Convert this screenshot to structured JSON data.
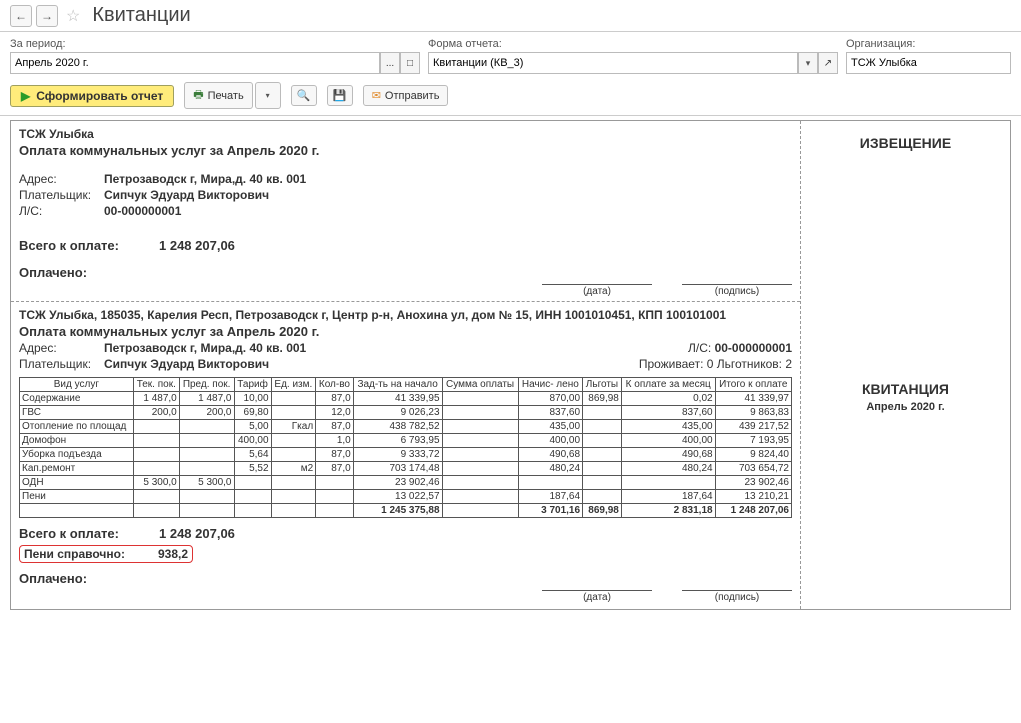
{
  "header": {
    "title": "Квитанции"
  },
  "filters": {
    "period_label": "За период:",
    "period_value": "Апрель 2020 г.",
    "form_label": "Форма отчета:",
    "form_value": "Квитанции (КВ_3)",
    "org_label": "Организация:",
    "org_value": "ТСЖ Улыбка"
  },
  "toolbar": {
    "run_label": "Сформировать отчет",
    "print_label": "Печать",
    "send_label": "Отправить"
  },
  "notice": {
    "title": "ИЗВЕЩЕНИЕ"
  },
  "receipt_side": {
    "title": "КВИТАНЦИЯ",
    "period": "Апрель 2020 г."
  },
  "top": {
    "org": "ТСЖ Улыбка",
    "heading": "Оплата коммунальных услуг за Апрель 2020 г.",
    "addr_label": "Адрес:",
    "addr_value": "Петрозаводск г, Мира,д. 40 кв. 001",
    "payer_label": "Плательщик:",
    "payer_value": "Сипчук Эдуард Викторович",
    "ls_label": "Л/С:",
    "ls_value": "00-000000001",
    "total_label": "Всего к оплате:",
    "total_value": "1 248 207,06",
    "paid_label": "Оплачено:",
    "date_label": "(дата)",
    "sig_label": "(подпись)"
  },
  "bottom": {
    "org_full": "ТСЖ Улыбка, 185035, Карелия Респ, Петрозаводск г, Центр р-н, Анохина ул, дом № 15, ИНН 1001010451, КПП 100101001",
    "heading": "Оплата коммунальных услуг за Апрель 2020 г.",
    "addr_label": "Адрес:",
    "addr_value": "Петрозаводск г, Мира,д. 40 кв. 001",
    "ls_label": "Л/С:",
    "ls_value": "00-000000001",
    "payer_label": "Плательщик:",
    "payer_value": "Сипчук Эдуард Викторович",
    "living_label": "Проживает: 0 Льготников: 2",
    "total_label": "Всего к оплате:",
    "total_value": "1 248 207,06",
    "peni_label": "Пени справочно:",
    "peni_value": "938,2",
    "paid_label": "Оплачено:",
    "date_label": "(дата)",
    "sig_label": "(подпись)"
  },
  "table": {
    "h_service": "Вид услуг",
    "h_cur": "Тек.\nпок.",
    "h_prev": "Пред.\nпок.",
    "h_tariff": "Тариф",
    "h_unit": "Ед.\nизм.",
    "h_qty": "Кол-во",
    "h_debt": "Зад-ть на\nначало",
    "h_sum": "Сумма\nоплаты",
    "h_acc": "Начис-\nлено",
    "h_lgot": "Льготы",
    "h_permonth": "К оплате\nза месяц",
    "h_total": "Итого\nк оплате",
    "rows": [
      {
        "s": "Содержание",
        "cur": "1 487,0",
        "prev": "1 487,0",
        "tar": "10,00",
        "u": "",
        "q": "87,0",
        "debt": "41 339,95",
        "so": "",
        "acc": "870,00",
        "lg": "869,98",
        "pm": "0,02",
        "tot": "41 339,97"
      },
      {
        "s": "ГВС",
        "cur": "200,0",
        "prev": "200,0",
        "tar": "69,80",
        "u": "",
        "q": "12,0",
        "debt": "9 026,23",
        "so": "",
        "acc": "837,60",
        "lg": "",
        "pm": "837,60",
        "tot": "9 863,83"
      },
      {
        "s": "Отопление по площад",
        "cur": "",
        "prev": "",
        "tar": "5,00",
        "u": "Гкал",
        "q": "87,0",
        "debt": "438 782,52",
        "so": "",
        "acc": "435,00",
        "lg": "",
        "pm": "435,00",
        "tot": "439 217,52"
      },
      {
        "s": "Домофон",
        "cur": "",
        "prev": "",
        "tar": "400,00",
        "u": "",
        "q": "1,0",
        "debt": "6 793,95",
        "so": "",
        "acc": "400,00",
        "lg": "",
        "pm": "400,00",
        "tot": "7 193,95"
      },
      {
        "s": "Уборка подъезда",
        "cur": "",
        "prev": "",
        "tar": "5,64",
        "u": "",
        "q": "87,0",
        "debt": "9 333,72",
        "so": "",
        "acc": "490,68",
        "lg": "",
        "pm": "490,68",
        "tot": "9 824,40"
      },
      {
        "s": "Кап.ремонт",
        "cur": "",
        "prev": "",
        "tar": "5,52",
        "u": "м2",
        "q": "87,0",
        "debt": "703 174,48",
        "so": "",
        "acc": "480,24",
        "lg": "",
        "pm": "480,24",
        "tot": "703 654,72"
      },
      {
        "s": "ОДН",
        "cur": "5 300,0",
        "prev": "5 300,0",
        "tar": "",
        "u": "",
        "q": "",
        "debt": "23 902,46",
        "so": "",
        "acc": "",
        "lg": "",
        "pm": "",
        "tot": "23 902,46"
      },
      {
        "s": "Пени",
        "cur": "",
        "prev": "",
        "tar": "",
        "u": "",
        "q": "",
        "debt": "13 022,57",
        "so": "",
        "acc": "187,64",
        "lg": "",
        "pm": "187,64",
        "tot": "13 210,21"
      }
    ],
    "total_row": {
      "debt": "1 245 375,88",
      "so": "",
      "acc": "3 701,16",
      "lg": "869,98",
      "pm": "2 831,18",
      "tot": "1 248 207,06"
    }
  }
}
